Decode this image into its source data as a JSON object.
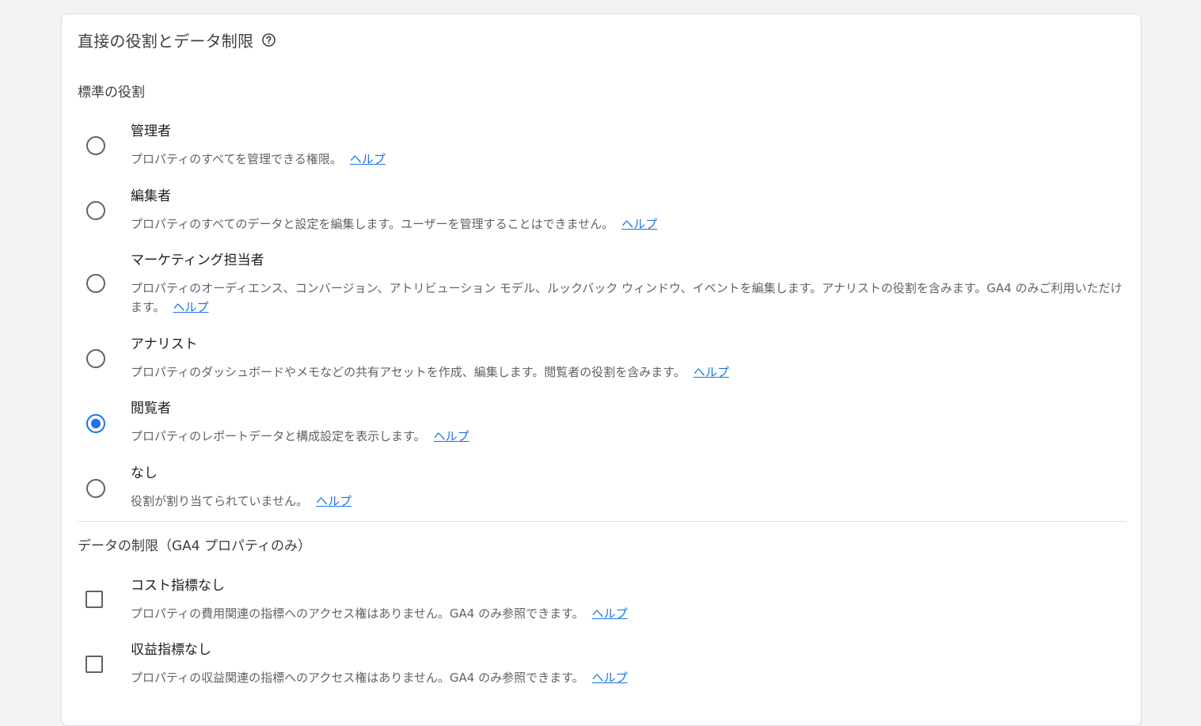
{
  "section": {
    "title": "直接の役割とデータ制限"
  },
  "standard_roles": {
    "label": "標準の役割",
    "options": [
      {
        "title": "管理者",
        "description": "プロパティのすべてを管理できる権限。",
        "help": "ヘルプ",
        "selected": false
      },
      {
        "title": "編集者",
        "description": "プロパティのすべてのデータと設定を編集します。ユーザーを管理することはできません。",
        "help": "ヘルプ",
        "selected": false
      },
      {
        "title": "マーケティング担当者",
        "description": "プロパティのオーディエンス、コンバージョン、アトリビューション モデル、ルックバック ウィンドウ、イベントを編集します。アナリストの役割を含みます。GA4 のみご利用いただけます。",
        "help": "ヘルプ",
        "selected": false
      },
      {
        "title": "アナリスト",
        "description": "プロパティのダッシュボードやメモなどの共有アセットを作成、編集します。閲覧者の役割を含みます。",
        "help": "ヘルプ",
        "selected": false
      },
      {
        "title": "閲覧者",
        "description": "プロパティのレポートデータと構成設定を表示します。",
        "help": "ヘルプ",
        "selected": true
      },
      {
        "title": "なし",
        "description": "役割が割り当てられていません。",
        "help": "ヘルプ",
        "selected": false
      }
    ]
  },
  "data_restrictions": {
    "label": "データの制限（GA4 プロパティのみ）",
    "options": [
      {
        "title": "コスト指標なし",
        "description": "プロパティの費用関連の指標へのアクセス権はありません。GA4 のみ参照できます。",
        "help": "ヘルプ",
        "checked": false
      },
      {
        "title": "収益指標なし",
        "description": "プロパティの収益関連の指標へのアクセス権はありません。GA4 のみ参照できます。",
        "help": "ヘルプ",
        "checked": false
      }
    ]
  }
}
